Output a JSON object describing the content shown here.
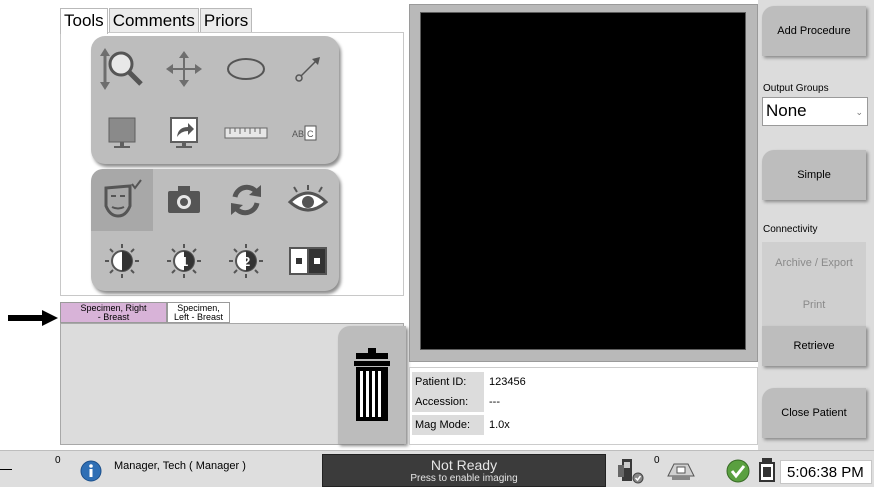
{
  "tabs": [
    "Tools",
    "Comments",
    "Priors"
  ],
  "specimen_tabs": {
    "right": [
      "Specimen, Right",
      "- Breast"
    ],
    "left": [
      "Specimen,",
      "Left - Breast"
    ]
  },
  "patient_info": {
    "rows": [
      {
        "label": "Patient ID:",
        "value": "123456"
      },
      {
        "label": "Accession:",
        "value": "---"
      },
      {
        "label": "Mag Mode:",
        "value": "1.0x"
      }
    ]
  },
  "sidebar": {
    "add_procedure": "Add Procedure",
    "output_groups_label": "Output Groups",
    "output_groups_value": "None",
    "simple": "Simple",
    "connectivity_label": "Connectivity",
    "archive_export": "Archive / Export",
    "print": "Print",
    "retrieve": "Retrieve",
    "close_patient": "Close Patient"
  },
  "status": {
    "left_count": "0",
    "user": "Manager, Tech ( Manager )",
    "not_ready_title": "Not Ready",
    "not_ready_sub": "Press to enable imaging",
    "right_count": "0",
    "time": "5:06:38 PM"
  },
  "icons": {
    "tools": [
      "zoom-icon",
      "pan-icon",
      "ellipse-icon",
      "arrow-annotation-icon",
      "monitor-icon",
      "send-to-monitor-icon",
      "ruler-icon",
      "text-annotation-icon",
      "face-check-icon",
      "camera-icon",
      "refresh-icon",
      "eye-icon",
      "contrast-icon",
      "contrast-1-icon",
      "contrast-2-icon",
      "invert-icon"
    ],
    "info": "info-icon",
    "trash": "trash-icon"
  }
}
